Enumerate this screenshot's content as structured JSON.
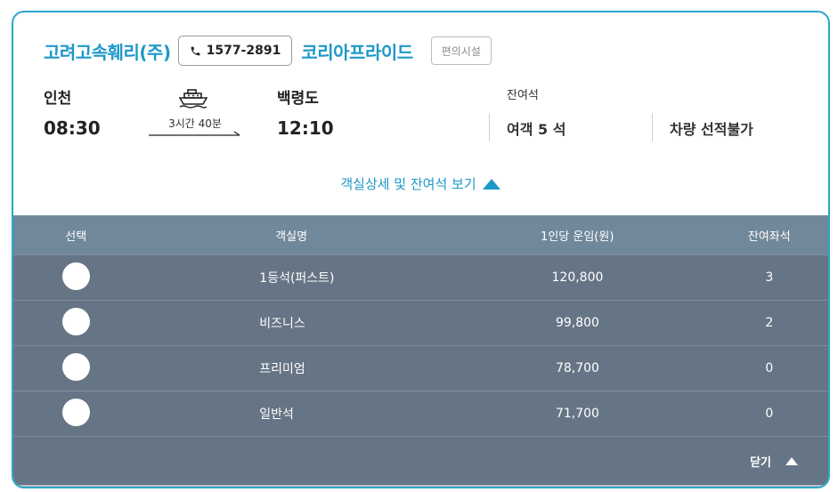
{
  "header": {
    "company": "고려고속훼리(주)",
    "phone": "1577-2891",
    "ship": "코리아프라이드",
    "facility_label": "편의시설"
  },
  "route": {
    "departure_city": "인천",
    "departure_time": "08:30",
    "duration": "3시간 40분",
    "arrival_city": "백령도",
    "arrival_time": "12:10"
  },
  "seats": {
    "label": "잔여석",
    "passenger": "여객 5 석",
    "vehicle": "차량 선적불가"
  },
  "toggle_label": "객실상세 및 잔여석 보기",
  "table": {
    "headers": [
      "선택",
      "객실명",
      "1인당 운임(원)",
      "잔여좌석"
    ],
    "rows": [
      {
        "name": "1등석(퍼스트)",
        "fare": "120,800",
        "remaining": "3"
      },
      {
        "name": "비즈니스",
        "fare": "99,800",
        "remaining": "2"
      },
      {
        "name": "프리미엄",
        "fare": "78,700",
        "remaining": "0"
      },
      {
        "name": "일반석",
        "fare": "71,700",
        "remaining": "0"
      }
    ]
  },
  "close_label": "닫기",
  "colors": {
    "accent": "#1d98c9",
    "panel": "#667585",
    "panel_header": "#71889a"
  }
}
